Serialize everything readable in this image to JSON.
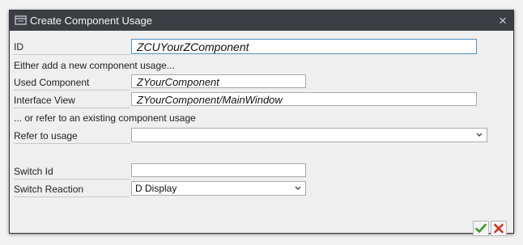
{
  "dialog": {
    "title": "Create Component Usage",
    "close_label": "×"
  },
  "fields": {
    "id": {
      "label": "ID",
      "value": "ZCUYourZComponent"
    },
    "hint_new": "Either add a new component usage...",
    "used_component": {
      "label": "Used Component",
      "value": "ZYourComponent"
    },
    "interface_view": {
      "label": "Interface View",
      "value": "ZYourComponent/MainWindow"
    },
    "hint_existing": "... or refer to an existing component usage",
    "refer_to_usage": {
      "label": "Refer to usage",
      "value": ""
    },
    "switch_id": {
      "label": "Switch Id",
      "value": ""
    },
    "switch_reaction": {
      "label": "Switch Reaction",
      "value": "D Display"
    }
  },
  "colors": {
    "titlebar": "#3b3f44",
    "focus_border": "#4a90c8",
    "confirm_green": "#3c9a2c",
    "cancel_red": "#d0321f"
  },
  "icons": {
    "title": "dialog-window-icon",
    "confirm": "checkmark-icon",
    "cancel": "cross-icon"
  }
}
